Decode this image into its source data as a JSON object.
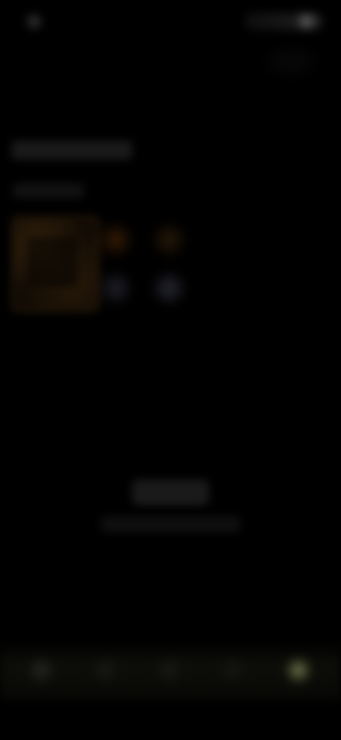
{
  "status_bar": {
    "time": "",
    "right_indicators": ""
  },
  "gallery": {
    "title": "",
    "subtitle": ""
  },
  "center": {
    "title": "",
    "subtitle": ""
  },
  "bottom_nav": {
    "items": [
      {
        "label": "",
        "icon": "home-icon"
      },
      {
        "label": "",
        "icon": "search-icon"
      },
      {
        "label": "",
        "icon": "add-icon"
      },
      {
        "label": "",
        "icon": "library-icon"
      },
      {
        "label": "",
        "icon": "profile-icon"
      }
    ]
  },
  "colors": {
    "background": "#000000",
    "accent": "#c8d28c",
    "thumb_warm": "#5a3c14"
  }
}
